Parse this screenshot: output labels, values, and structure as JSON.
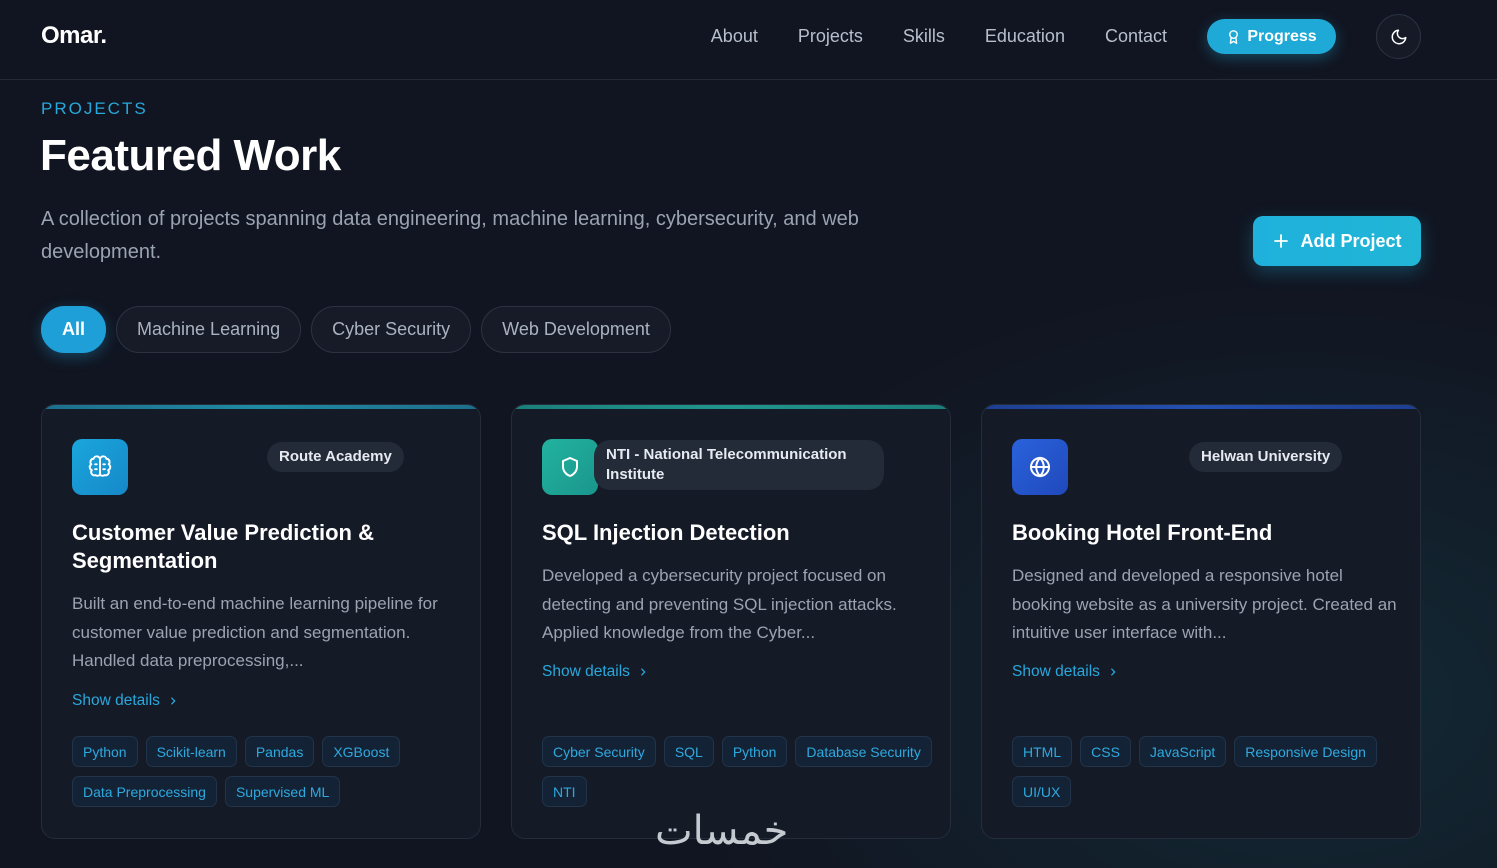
{
  "nav": {
    "logo": "Omar.",
    "links": [
      "About",
      "Projects",
      "Skills",
      "Education",
      "Contact"
    ],
    "progress_label": "Progress"
  },
  "header": {
    "eyebrow": "PROJECTS",
    "title": "Featured Work",
    "subtitle": "A collection of projects spanning data engineering, machine learning, cybersecurity, and web development.",
    "add_label": "Add Project"
  },
  "filters": [
    "All",
    "Machine Learning",
    "Cyber Security",
    "Web Development"
  ],
  "cards": [
    {
      "icon": "brain-icon",
      "org": "Route Academy",
      "title": "Customer Value Prediction & Segmentation",
      "description": "Built an end-to-end machine learning pipeline for customer value prediction and segmentation. Handled data preprocessing,...",
      "show_details": "Show details",
      "tags": [
        "Python",
        "Scikit-learn",
        "Pandas",
        "XGBoost",
        "Data Preprocessing",
        "Supervised ML"
      ]
    },
    {
      "icon": "shield-icon",
      "org": "NTI - National Telecommunication Institute",
      "title": "SQL Injection Detection",
      "description": "Developed a cybersecurity project focused on detecting and preventing SQL injection attacks. Applied knowledge from the Cyber...",
      "show_details": "Show details",
      "tags": [
        "Cyber Security",
        "SQL",
        "Python",
        "Database Security",
        "NTI"
      ]
    },
    {
      "icon": "globe-icon",
      "org": "Helwan University",
      "title": "Booking Hotel Front-End",
      "description": "Designed and developed a responsive hotel booking website as a university project. Created an intuitive user interface with...",
      "show_details": "Show details",
      "tags": [
        "HTML",
        "CSS",
        "JavaScript",
        "Responsive Design",
        "UI/UX"
      ]
    }
  ],
  "watermark": "خمسات",
  "colors": {
    "accent": "#1fa9d6",
    "background": "#111521",
    "card": "#151a27",
    "tag_text": "#2ea9de"
  }
}
